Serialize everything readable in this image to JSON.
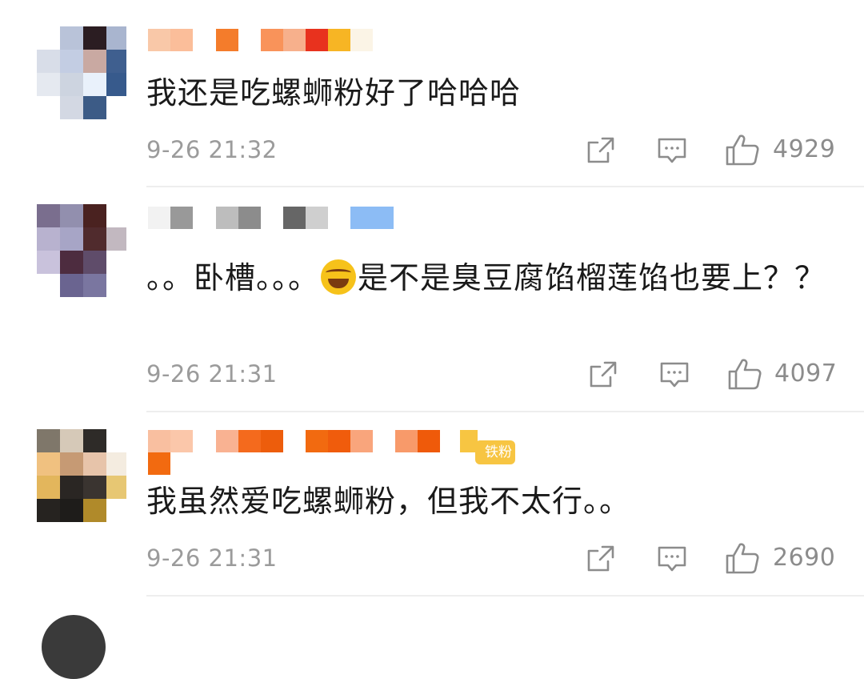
{
  "comments": [
    {
      "text": "我还是吃螺蛳粉好了哈哈哈",
      "time": "9-26 21:32",
      "likes": "4929"
    },
    {
      "text_before_emoji": "。。卧槽。。。",
      "emoji": "crying-laughing-emoji",
      "text_after_emoji": "是不是臭豆腐馅榴莲馅也要上？？",
      "time": "9-26 21:31",
      "likes": "4097"
    },
    {
      "text": "我虽然爱吃螺蛳粉，但我不太行。。",
      "badge": "铁粉",
      "time": "9-26 21:31",
      "likes": "2690"
    }
  ],
  "icons": {
    "share": "share-icon",
    "reply": "comment-icon",
    "like": "thumbs-up-icon"
  },
  "colors": {
    "text": "#1a1a1a",
    "meta": "#9b9b9b",
    "badge": "#f7c542"
  }
}
